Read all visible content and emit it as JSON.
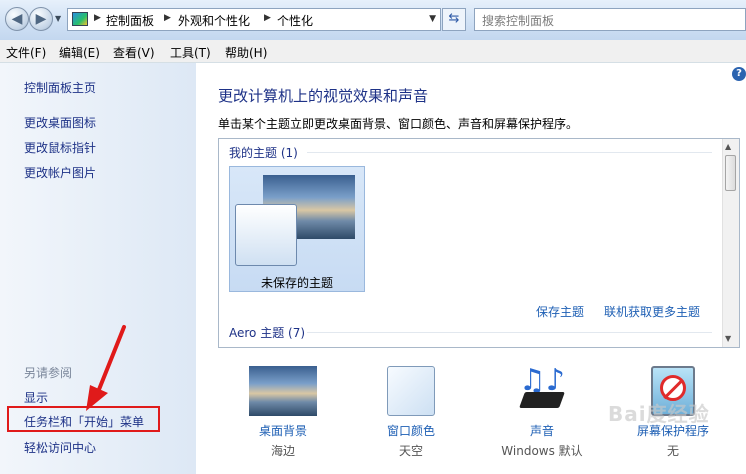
{
  "address": {
    "crumbs": [
      "控制面板",
      "外观和个性化",
      "个性化"
    ],
    "search_placeholder": "搜索控制面板"
  },
  "menubar": [
    "文件(F)",
    "编辑(E)",
    "查看(V)",
    "工具(T)",
    "帮助(H)"
  ],
  "left": {
    "home": "控制面板主页",
    "tasks": [
      "更改桌面图标",
      "更改鼠标指针",
      "更改帐户图片"
    ],
    "see_also_label": "另请参阅",
    "see_also": [
      "显示",
      "任务栏和「开始」菜单",
      "轻松访问中心"
    ]
  },
  "main": {
    "title": "更改计算机上的视觉效果和声音",
    "subtitle": "单击某个主题立即更改桌面背景、窗口颜色、声音和屏幕保护程序。",
    "my_themes": "我的主题 (1)",
    "unsaved_theme": "未保存的主题",
    "save_theme": "保存主题",
    "get_more": "联机获取更多主题",
    "aero_themes": "Aero 主题 (7)"
  },
  "options": [
    {
      "name": "桌面背景",
      "value": "海边",
      "icon": "desktop-background-icon"
    },
    {
      "name": "窗口颜色",
      "value": "天空",
      "icon": "window-color-icon"
    },
    {
      "name": "声音",
      "value": "Windows 默认",
      "icon": "sound-icon"
    },
    {
      "name": "屏幕保护程序",
      "value": "无",
      "icon": "screensaver-icon"
    }
  ],
  "watermark": "Bai度经验",
  "colors": {
    "link": "#1e3287",
    "highlight_box": "#e01a1a"
  }
}
